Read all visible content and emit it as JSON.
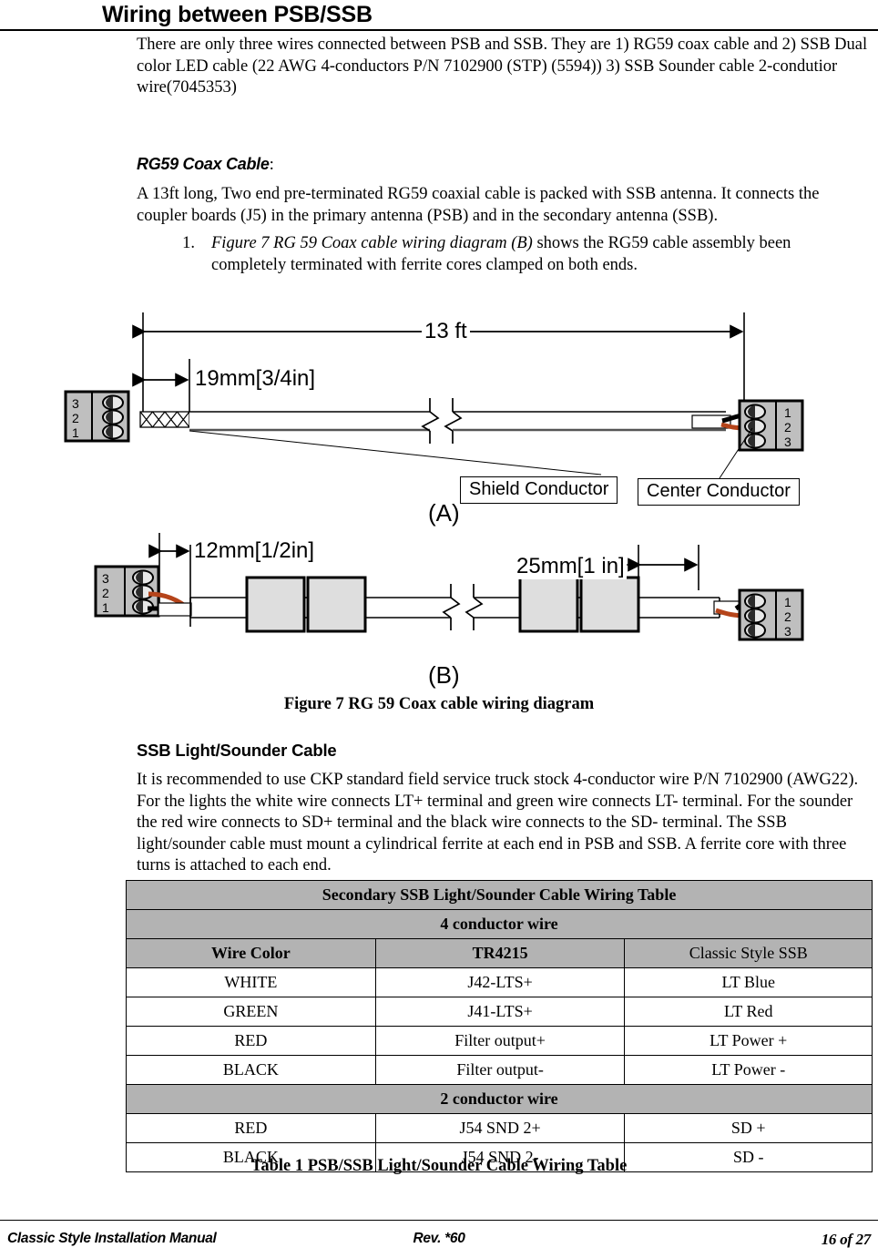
{
  "page": {
    "title": "Wiring between PSB/SSB",
    "intro": "There are only three  wires connected between PSB and SSB. They are 1) RG59 coax cable and 2) SSB Dual color LED cable (22 AWG 4-conductors P/N 7102900  (STP) (5594)) 3) SSB Sounder cable 2-condutior wire(7045353)"
  },
  "rg59": {
    "heading": "RG59 Coax Cable",
    "heading_suffix": ":",
    "paragraph": "A 13ft long, Two end pre-terminated RG59 coaxial cable is packed with SSB antenna. It connects the coupler boards (J5) in the primary antenna (PSB) and in the secondary antenna (SSB).",
    "list": [
      {
        "number": "1.",
        "italic_part": "Figure 7 RG 59 Coax cable wiring diagram (B)",
        "rest": " shows the RG59 cable assembly been completely terminated with ferrite cores clamped on both ends."
      }
    ]
  },
  "figure": {
    "caption": "Figure 7 RG 59 Coax cable wiring diagram",
    "panel_a_label": "(A)",
    "panel_b_label": "(B)",
    "dim_13ft": "13 ft",
    "dim_19mm": "19mm[3/4in]",
    "dim_12mm": "12mm[1/2in]",
    "dim_25mm": "25mm[1 in]",
    "callout_shield": "Shield Conductor",
    "callout_center": "Center Conductor",
    "terminal_pins_left": [
      "3",
      "2",
      "1"
    ],
    "terminal_pins_right": [
      "1",
      "2",
      "3"
    ],
    "colors": {
      "center_conductor": "#b5441a",
      "shield_conductor": "#000000",
      "terminal_body": "#bfbfbf",
      "ferrite_fill": "#dedede"
    }
  },
  "ssb_cable": {
    "heading": "SSB Light/Sounder Cable",
    "paragraph": "It is recommended to use CKP standard field service truck stock 4-conductor wire P/N 7102900 (AWG22). For the lights the white wire connects LT+ terminal and green wire connects LT- terminal. For the sounder the red wire connects to SD+ terminal and the black wire connects to the SD- terminal. The SSB light/sounder cable must mount a cylindrical ferrite at each end in PSB and SSB. A ferrite core with three turns is attached to each end."
  },
  "table": {
    "title": "Secondary SSB Light/Sounder Cable Wiring Table",
    "section_4cond": "4 conductor wire",
    "section_2cond": "2 conductor wire",
    "headers": [
      "Wire Color",
      "TR4215",
      "Classic  Style SSB"
    ],
    "rows_4cond": [
      [
        "WHITE",
        "J42-LTS+",
        "LT Blue"
      ],
      [
        "GREEN",
        "J41-LTS+",
        "LT Red"
      ],
      [
        "RED",
        "Filter output+",
        "LT Power +"
      ],
      [
        "BLACK",
        "Filter output-",
        "LT Power -"
      ]
    ],
    "rows_2cond": [
      [
        "RED",
        "J54 SND 2+",
        "SD +"
      ],
      [
        "BLACK",
        "J54 SND 2-",
        "SD -"
      ]
    ],
    "caption": "Table 1 PSB/SSB Light/Sounder Cable Wiring Table"
  },
  "footer": {
    "left": "Classic Style Installation Manual",
    "middle": "Rev. *60",
    "right": "16 of 27"
  }
}
